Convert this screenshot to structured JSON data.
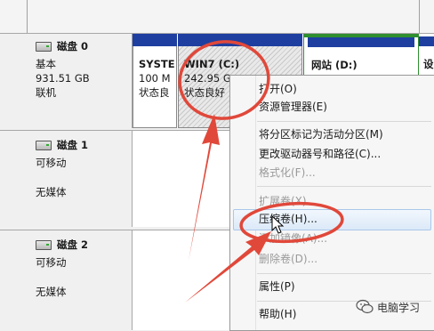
{
  "disks": [
    {
      "title": "磁盘 0",
      "type": "基本",
      "size": "931.51 GB",
      "status": "联机"
    },
    {
      "title": "磁盘 1",
      "type": "可移动",
      "size": "",
      "status": "无媒体"
    },
    {
      "title": "磁盘 2",
      "type": "可移动",
      "size": "",
      "status": "无媒体"
    }
  ],
  "partitions": {
    "system": {
      "name": "SYSTE",
      "size": "100 M",
      "status": "状态良"
    },
    "win7": {
      "name": "WIN7  (C:)",
      "size": "242.95 G",
      "status": "状态良好"
    },
    "website": {
      "name": "网站  (D:)"
    },
    "edge": {
      "name": "设"
    }
  },
  "context_menu": {
    "items": [
      {
        "label": "打开(O)",
        "enabled": true
      },
      {
        "label": "资源管理器(E)",
        "enabled": true
      },
      {
        "label": "将分区标记为活动分区(M)",
        "enabled": true
      },
      {
        "label": "更改驱动器号和路径(C)...",
        "enabled": true
      },
      {
        "label": "格式化(F)...",
        "enabled": false
      },
      {
        "label": "扩展卷(X)...",
        "enabled": false
      },
      {
        "label": "压缩卷(H)...",
        "enabled": true,
        "highlighted": true
      },
      {
        "label": "添加镜像(A)...",
        "enabled": false
      },
      {
        "label": "删除卷(D)...",
        "enabled": false
      },
      {
        "label": "属性(P)",
        "enabled": true
      },
      {
        "label": "帮助(H)",
        "enabled": true
      }
    ]
  },
  "annotation_color": "#e0483a",
  "watermark": {
    "text": "电脑学习",
    "icon": "wechat-icon"
  }
}
